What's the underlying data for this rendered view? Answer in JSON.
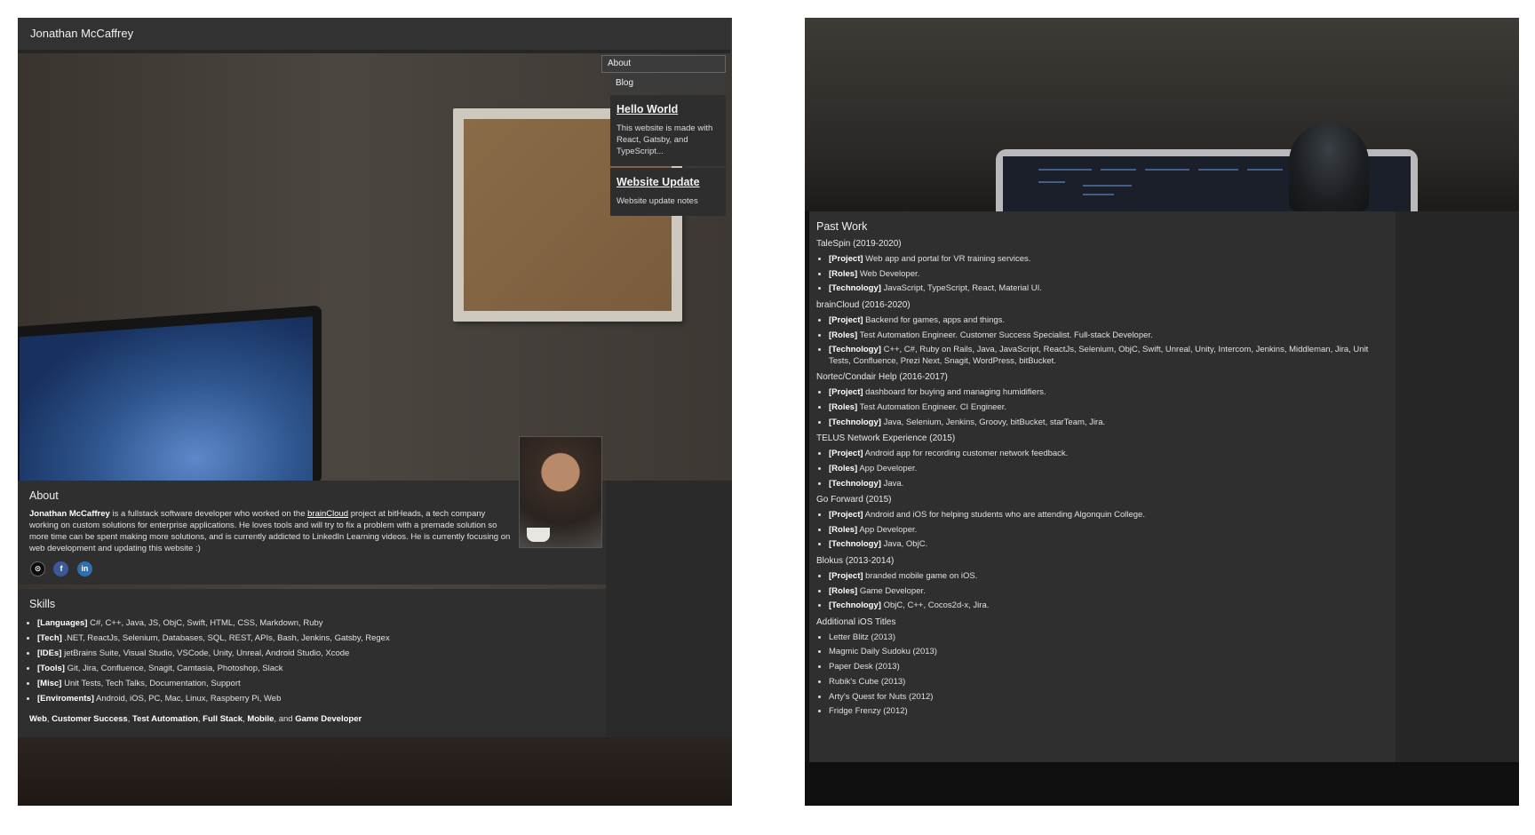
{
  "header": {
    "site_title": "Jonathan McCaffrey"
  },
  "nav": {
    "about": "About",
    "blog": "Blog"
  },
  "blog_posts": [
    {
      "title": "Hello World",
      "excerpt": "This website is made with React, Gatsby, and TypeScript..."
    },
    {
      "title": "Website Update",
      "excerpt": "Website update notes"
    }
  ],
  "about": {
    "heading": "About",
    "name": "Jonathan McCaffrey",
    "text_before_link": " is a fullstack software developer who worked on the ",
    "link_text": "brainCloud",
    "text_after_link": " project at bitHeads, a tech company working on custom solutions for enterprise applications. He loves tools and will try to fix a problem with a premade solution so more time can be spent making more solutions, and is currently addicted to LinkedIn Learning videos. He is currently focusing on web development and updating this website :)",
    "social": {
      "github": "github-icon",
      "facebook": "facebook-icon",
      "linkedin": "linkedin-icon",
      "facebook_glyph": "f",
      "linkedin_glyph": "in",
      "github_glyph": "⊙"
    }
  },
  "skills": {
    "heading": "Skills",
    "items": [
      {
        "label": "[Languages]",
        "value": " C#, C++, Java, JS, ObjC, Swift, HTML, CSS, Markdown, Ruby"
      },
      {
        "label": "[Tech]",
        "value": " .NET, ReactJs, Selenium, Databases, SQL, REST, APIs, Bash, Jenkins, Gatsby, Regex"
      },
      {
        "label": "[IDEs]",
        "value": " jetBrains Suite, Visual Studio, VSCode, Unity, Unreal, Android Studio, Xcode"
      },
      {
        "label": "[Tools]",
        "value": " Git, Jira, Confluence, Snagit, Camtasia, Photoshop, Slack"
      },
      {
        "label": "[Misc]",
        "value": " Unit Tests, Tech Talks, Documentation, Support"
      },
      {
        "label": "[Enviroments]",
        "value": " Android, iOS, PC, Mac, Linux, Raspberry Pi, Web"
      }
    ],
    "summary": {
      "web": "Web",
      "cs": "Customer Success",
      "ta": "Test Automation",
      "fs": "Full Stack",
      "mobile": "Mobile",
      "and": ", and ",
      "sep": ", ",
      "game": "Game Developer"
    }
  },
  "past_work": {
    "heading": "Past Work",
    "jobs": [
      {
        "title": "TaleSpin (2019-2020)",
        "project": " Web app and portal for VR training services.",
        "roles": " Web Developer.",
        "technology": " JavaScript, TypeScript, React, Material UI."
      },
      {
        "title": "brainCloud (2016-2020)",
        "project": " Backend for games, apps and things.",
        "roles": " Test Automation Engineer. Customer Success Specialist. Full-stack Developer.",
        "technology": " C++, C#, Ruby on Rails, Java, JavaScript, ReactJs, Selenium, ObjC, Swift, Unreal, Unity, Intercom, Jenkins, Middleman, Jira, Unit Tests, Confluence, Prezi Next, Snagit, WordPress, bitBucket."
      },
      {
        "title": "Nortec/Condair Help (2016-2017)",
        "project": " dashboard for buying and managing humidifiers.",
        "roles": " Test Automation Engineer. CI Engineer.",
        "technology": " Java, Selenium, Jenkins, Groovy, bitBucket, starTeam, Jira."
      },
      {
        "title": "TELUS Network Experience (2015)",
        "project": " Android app for recording customer network feedback.",
        "roles": " App Developer.",
        "technology": " Java."
      },
      {
        "title": "Go Forward (2015)",
        "project": " Android and iOS for helping students who are attending Algonquin College.",
        "roles": " App Developer.",
        "technology": " Java, ObjC."
      },
      {
        "title": "Blokus (2013-2014)",
        "project": " branded mobile game on iOS.",
        "roles": " Game Developer.",
        "technology": " ObjC, C++, Cocos2d-x, Jira."
      }
    ],
    "labels": {
      "project": "[Project]",
      "roles": "[Roles]",
      "technology": "[Technology]"
    },
    "additional": {
      "title": "Additional iOS Titles",
      "items": [
        "Letter Blitz (2013)",
        "Magmic Daily Sudoku (2013)",
        "Paper Desk (2013)",
        "Rubik's Cube (2013)",
        "Arty's Quest for Nuts (2012)",
        "Fridge Frenzy (2012)"
      ]
    }
  }
}
